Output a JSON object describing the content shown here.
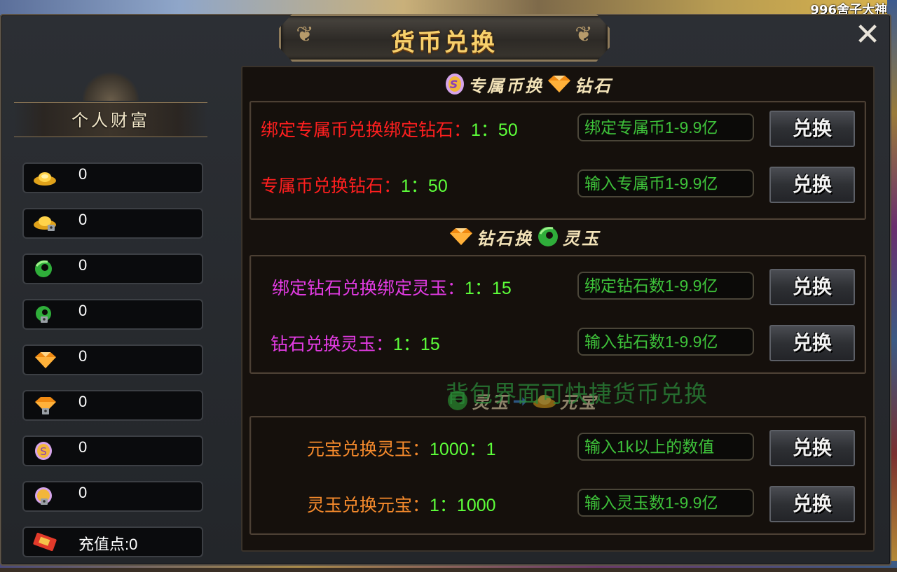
{
  "background": {
    "top_right_text": "996舍子大神"
  },
  "window": {
    "title": "货币兑换",
    "close_icon": "close-icon"
  },
  "wealth": {
    "title": "个人财富",
    "items": [
      {
        "icon": "gold-ingot-icon",
        "value": "0"
      },
      {
        "icon": "bound-gold-ingot-icon",
        "value": "0"
      },
      {
        "icon": "jade-icon",
        "value": "0"
      },
      {
        "icon": "bound-jade-icon",
        "value": "0"
      },
      {
        "icon": "diamond-icon",
        "value": "0"
      },
      {
        "icon": "bound-diamond-icon",
        "value": "0"
      },
      {
        "icon": "exclusive-coin-icon",
        "value": "0"
      },
      {
        "icon": "bound-exclusive-coin-icon",
        "value": "0"
      },
      {
        "icon": "recharge-points-icon",
        "value": "充值点:0"
      }
    ]
  },
  "sections": [
    {
      "title_from": "专属币换",
      "title_to": "钻石",
      "rows": [
        {
          "label": "绑定专属币兑换绑定钻石：",
          "ratio": "1：50",
          "placeholder": "绑定专属币1-9.9亿",
          "button": "兑换"
        },
        {
          "label": "专属币兑换钻石：",
          "ratio": "1：50",
          "placeholder": "输入专属币1-9.9亿",
          "button": "兑换"
        }
      ]
    },
    {
      "title_from": "钻石换",
      "title_to": "灵玉",
      "rows": [
        {
          "label": "绑定钻石兑换绑定灵玉：",
          "ratio": "1：15",
          "placeholder": "绑定钻石数1-9.9亿",
          "button": "兑换"
        },
        {
          "label": "钻石兑换灵玉：",
          "ratio": "1：15",
          "placeholder": "输入钻石数1-9.9亿",
          "button": "兑换"
        }
      ]
    },
    {
      "title_from": "灵玉",
      "title_to": "元宝",
      "rows": [
        {
          "label": "元宝兑换灵玉：",
          "ratio": "1000：1",
          "placeholder": "输入1k以上的数值",
          "button": "兑换"
        },
        {
          "label": "灵玉兑换元宝：",
          "ratio": "1：1000",
          "placeholder": "输入灵玉数1-9.9亿",
          "button": "兑换"
        }
      ]
    }
  ],
  "hint": "背包界面可快捷货币兑换",
  "colors": {
    "ratio_green": "#5dff3a",
    "section1_label": "#ff1f1f",
    "section2_label": "#e23be3",
    "section3_label": "#f58a2c",
    "title_gold": "#f7d06b"
  }
}
